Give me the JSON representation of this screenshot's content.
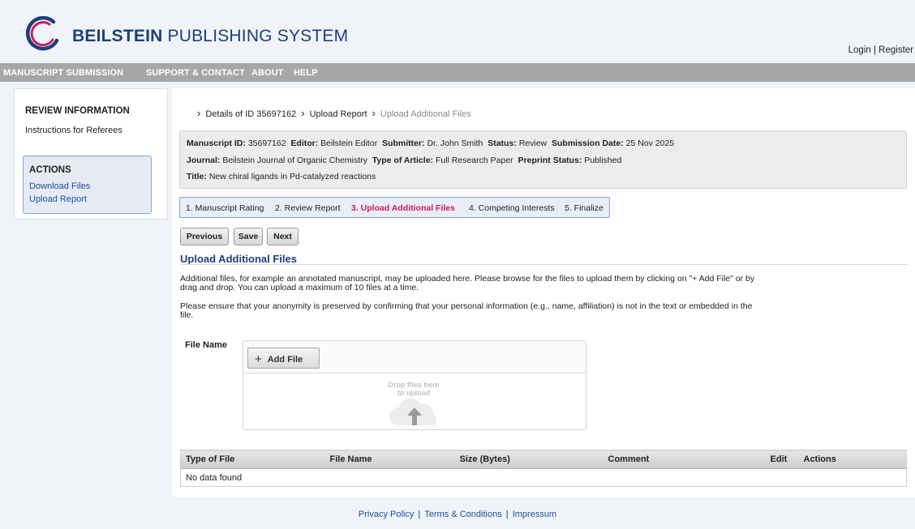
{
  "brand": {
    "bold": "BEILSTEIN",
    "rest": "PUBLISHING SYSTEM"
  },
  "auth": {
    "login": "Login",
    "register": "Register"
  },
  "nav": [
    "MANUSCRIPT SUBMISSION",
    "SUPPORT & CONTACT",
    "ABOUT",
    "HELP"
  ],
  "sidebar": {
    "title": "REVIEW INFORMATION",
    "instructions": "Instructions for Referees",
    "actions_title": "ACTIONS",
    "actions": [
      "Download Files",
      "Upload Report"
    ]
  },
  "breadcrumb": [
    "Details of ID 35697162",
    "Upload Report",
    "Upload Additional Files"
  ],
  "manuscript": {
    "id_label": "Manuscript ID:",
    "id": "35697162",
    "editor_label": "Editor:",
    "editor": "Beilstein Editor",
    "submitter_label": "Submitter:",
    "submitter": "Dr. John Smith",
    "status_label": "Status:",
    "status": "Review",
    "date_label": "Submission Date:",
    "date": "25 Nov 2025",
    "journal_label": "Journal:",
    "journal": "Beilstein Journal of Organic Chemistry",
    "type_label": "Type of Article:",
    "type": "Full Research Paper",
    "preprint_label": "Preprint Status:",
    "preprint": "Published",
    "title_label": "Title:",
    "title": "New chiral ligands in Pd-catalyzed reactions"
  },
  "steps": [
    {
      "label": "1. Manuscript Rating",
      "active": false
    },
    {
      "label": "2. Review Report",
      "active": false
    },
    {
      "label": "3. Upload Additional Files",
      "active": true
    },
    {
      "label": "4. Competing Interests",
      "active": false
    },
    {
      "label": "5. Finalize",
      "active": false
    }
  ],
  "buttons": {
    "previous": "Previous",
    "save": "Save",
    "next": "Next"
  },
  "section_title": "Upload Additional Files",
  "paragraphs": [
    "Additional files, for example an annotated manuscript, may be uploaded here. Please browse for the files to upload them by clicking on \"+ Add File\" or by drag and drop. You can upload a maximum of 10 files at a time.",
    "Please ensure that your anonymity is preserved by confirming that your personal information (e.g., name, affiliation) is not in the text or embedded in the file."
  ],
  "upload": {
    "file_name_label": "File Name",
    "add_file": "Add File",
    "drop_line1": "Drop files here",
    "drop_line2": "to upload"
  },
  "table": {
    "headers": [
      "Type of File",
      "File Name",
      "Size (Bytes)",
      "Comment",
      "Edit",
      "Actions"
    ],
    "empty": "No data found"
  },
  "footer": [
    "Privacy Policy",
    "Terms & Conditions",
    "Impressum"
  ],
  "colors": {
    "brand_blue": "#1c3f7a",
    "active_step": "#d01c5c",
    "nav_gray": "#a7a7a7"
  }
}
